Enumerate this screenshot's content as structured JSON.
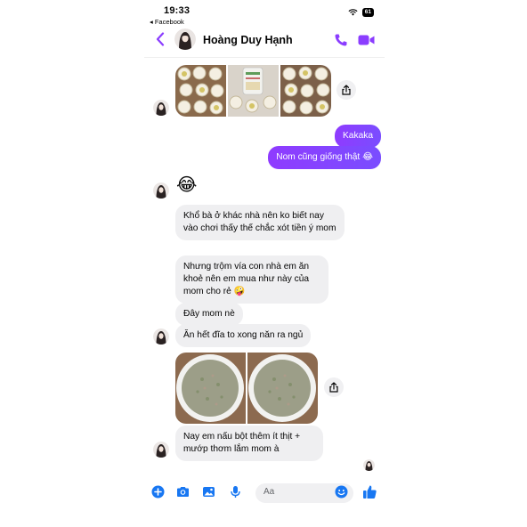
{
  "status": {
    "time": "19:33",
    "back_app": "◂ Facebook",
    "battery": "61"
  },
  "header": {
    "contact_name": "Hoàng Duy Hạnh"
  },
  "messages": {
    "out1": "Kakaka",
    "out2": "Nom cũng giống thật 😂",
    "in_emoji": "😂",
    "in1": "Khổ bà ở khác nhà nên ko biết nay vào chơi thấy thế chắc xót tiền ý mom",
    "in2": "Nhưng trộm vía con nhà em ăn khoẻ nên em mua như này của mom cho rẻ 🤪",
    "in3": "Đây mom nè",
    "in4": "Ăn hết đĩa to xong năn ra ngủ",
    "in5": "Nay em nấu bột thêm ít thịt + mướp thơm lắm mom à"
  },
  "input": {
    "placeholder": "Aa"
  },
  "colors": {
    "accent": "#8b3dff",
    "bubble_in": "#efeff1",
    "input_icons": "#1877f2"
  },
  "icons": [
    "back-chevron-icon",
    "phone-icon",
    "video-call-icon",
    "share-icon",
    "plus-icon",
    "camera-icon",
    "gallery-icon",
    "microphone-icon",
    "emoji-icon",
    "like-icon",
    "wifi-icon"
  ]
}
